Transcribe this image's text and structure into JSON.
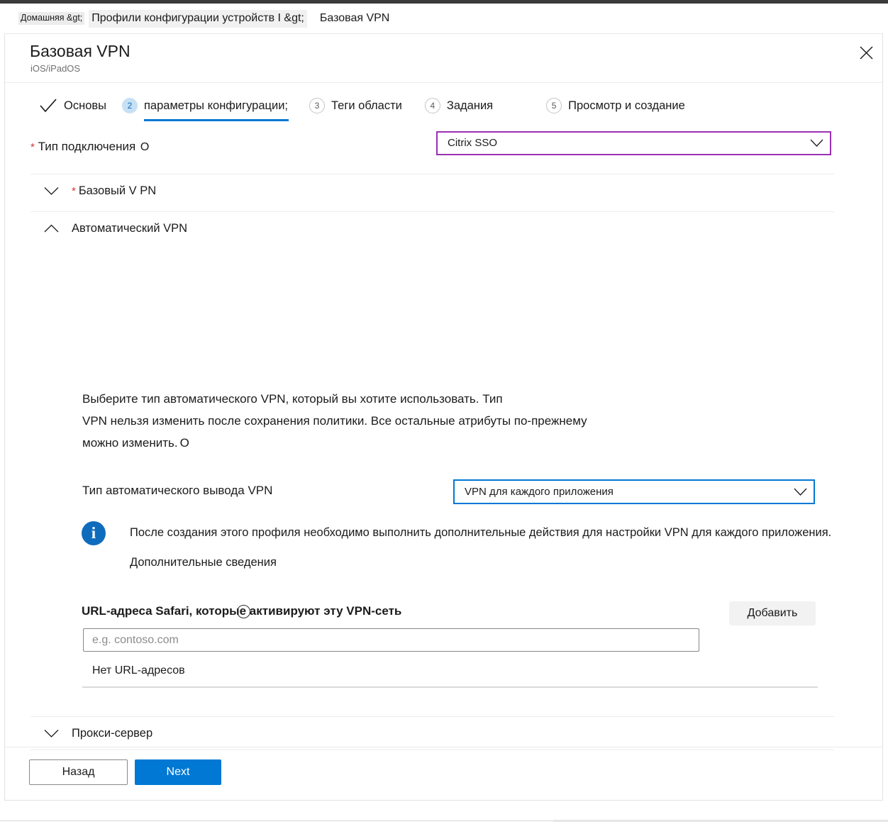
{
  "breadcrumb": {
    "home": "Домашняя &gt;",
    "middle": "Профили конфигурации устройств I &gt;",
    "current": "Базовая VPN"
  },
  "blade": {
    "title": "Базовая VPN",
    "subtitle": "iOS/iPadOS",
    "close_icon": "close-icon"
  },
  "wizard": {
    "steps": [
      {
        "badge": "check",
        "label": "Основы",
        "state": "complete"
      },
      {
        "badge": "2",
        "label": "параметры конфигурации;",
        "state": "active"
      },
      {
        "badge": "3",
        "label": "Теги области",
        "state": "idle"
      },
      {
        "badge": "4",
        "label": "Задания",
        "state": "idle"
      },
      {
        "badge": "5",
        "label": "Просмотр и создание",
        "state": "idle"
      }
    ]
  },
  "connection": {
    "required_mark": "*",
    "label": "Тип подключения",
    "info_glyph": "O",
    "value": "Citrix SSO",
    "border_color": "#9b30b5",
    "caret_icon": "chevron-down-icon"
  },
  "sections": {
    "base_vpn": {
      "required_mark": "*",
      "title": "Базовый V PN",
      "chevron": "chevron-down-icon",
      "expanded": false
    },
    "auto_vpn": {
      "title": "Автоматический VPN",
      "chevron": "chevron-up-icon",
      "expanded": true
    },
    "proxy": {
      "title": "Прокси-сервер",
      "chevron": "chevron-down-icon",
      "expanded": false
    }
  },
  "auto_vpn": {
    "description_line1": "Выберите тип автоматического VPN, который вы хотите использовать. Тип",
    "description_line2": "VPN нельзя изменить после сохранения политики. Все остальные атрибуты по-прежнему",
    "description_line3": "можно изменить.",
    "description_info_glyph": "O",
    "type_label": "Тип автоматического вывода VPN",
    "type_value": "VPN для каждого приложения",
    "type_border_color": "#0078d4",
    "info_message": "После создания этого профиля необходимо выполнить дополнительные действия для настройки VPN для каждого приложения.",
    "info_link": "Дополнительные сведения",
    "info_icon_color": "#0f6cbd"
  },
  "safari_urls": {
    "label": "URL-адреса Safari, которые активируют эту VPN-сеть",
    "add_button": "Добавить",
    "input_value": "",
    "input_placeholder": "e.g. contoso.com",
    "empty_text": "Нет URL-адресов"
  },
  "footer": {
    "back_label": "Назад",
    "next_label": "Next",
    "next_color": "#0078d4"
  }
}
